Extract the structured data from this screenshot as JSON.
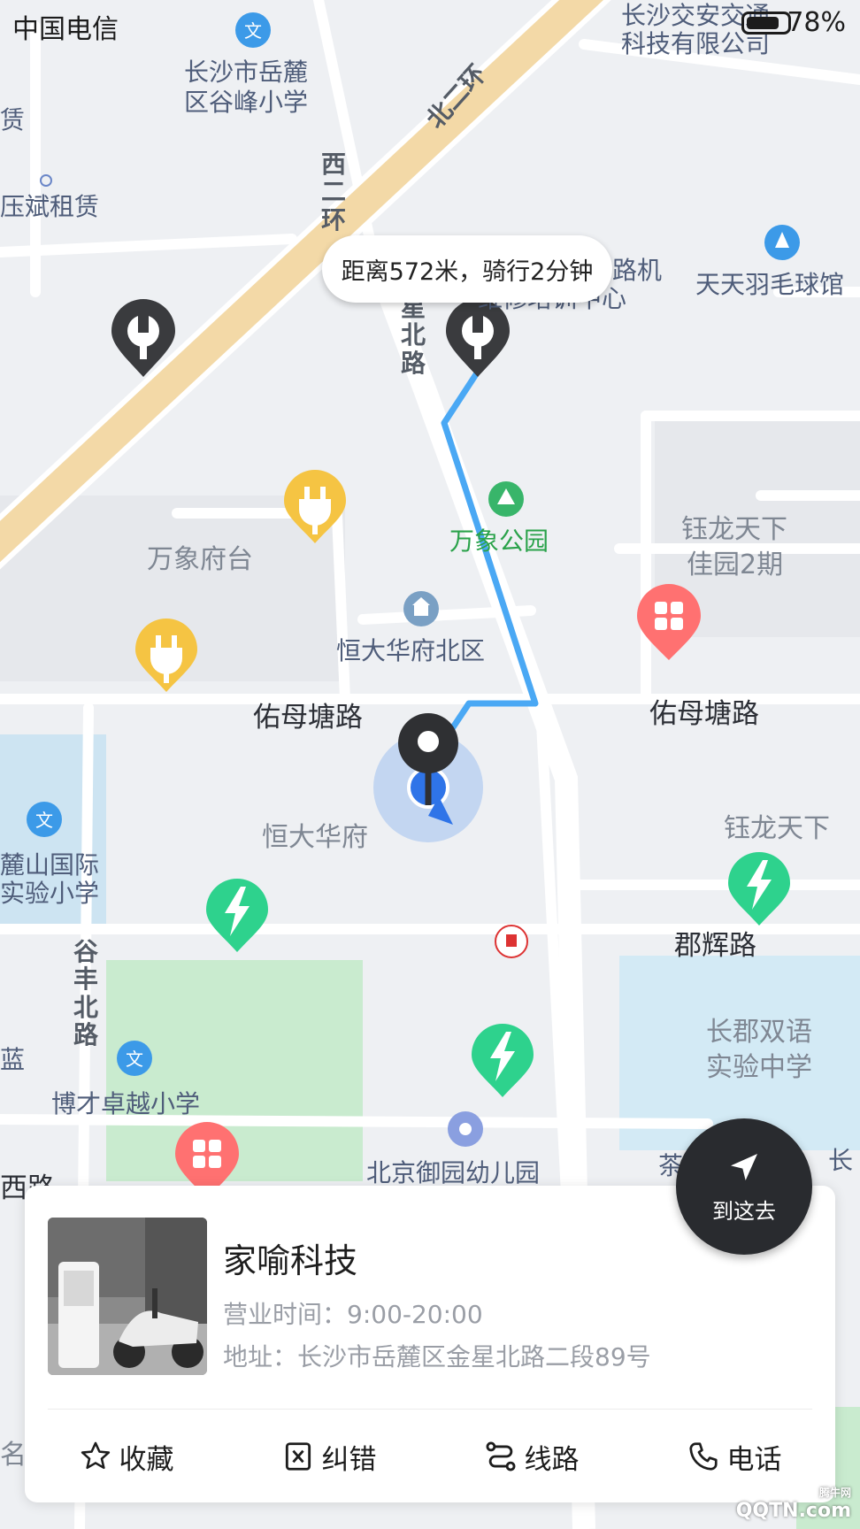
{
  "status_bar": {
    "carrier": "中国电信",
    "battery": "78%"
  },
  "map": {
    "route_bubble": "距离572米，骑行2分钟",
    "labels": [
      "长沙交安交通",
      "科技有限公司",
      "长沙市岳麓",
      "区谷峰小学",
      "赁",
      "压斌租赁",
      "西二环",
      "北二环",
      "星北路",
      "路机",
      "维修培训中心",
      "天天羽毛球馆",
      "万象公园",
      "钰龙天下",
      "佳园2期",
      "万象府台",
      "恒大华府北区",
      "佑母塘路",
      "佑母塘路",
      "恒大华府",
      "钰龙天下",
      "麓山国际",
      "实验小学",
      "郡辉路",
      "谷丰北路",
      "长郡双语",
      "实验中学",
      "蓝",
      "博才卓越小学",
      "北京御园幼儿园",
      "茶",
      "长",
      "西路",
      "名"
    ]
  },
  "navigate_button": {
    "label": "到这去"
  },
  "poi_card": {
    "title": "家喻科技",
    "hours": "营业时间：9:00-20:00",
    "address": "地址：长沙市岳麓区金星北路二段89号",
    "actions": [
      {
        "label": "收藏",
        "icon": "star-icon"
      },
      {
        "label": "纠错",
        "icon": "error-report-icon"
      },
      {
        "label": "线路",
        "icon": "route-icon"
      },
      {
        "label": "电话",
        "icon": "phone-icon"
      }
    ]
  },
  "watermark": {
    "brand": "QQTN",
    "suffix": ".com",
    "small": "腾牛网"
  },
  "colors": {
    "map_background": "#eef0f3",
    "major_road": "#f3d9a7",
    "route_line": "#4aa8f4",
    "shop_pin": "#3a3b3e",
    "charger_pin": "#f5c443",
    "fast_charge_pin": "#2ed28d",
    "service_pin": "#ff7171"
  }
}
